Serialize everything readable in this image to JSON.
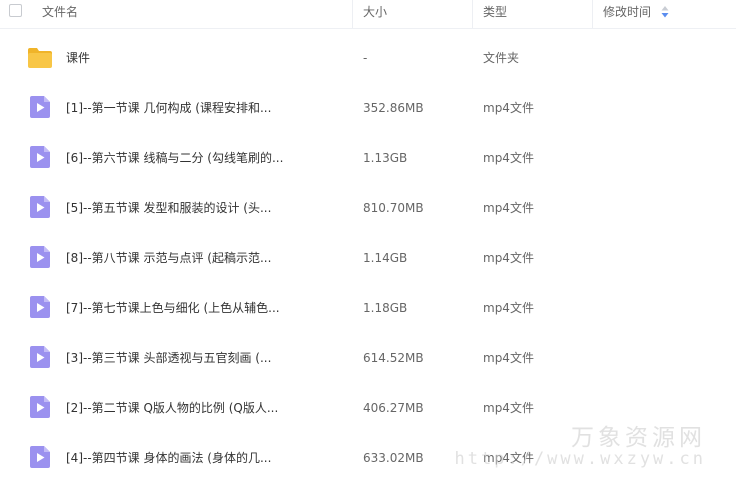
{
  "header": {
    "name_label": "文件名",
    "size_label": "大小",
    "type_label": "类型",
    "modified_label": "修改时间"
  },
  "colors": {
    "folder": "#f8c646",
    "video": "#9b91ef",
    "sort_active": "#5b8def"
  },
  "rows": [
    {
      "name": "课件",
      "size": "-",
      "type": "文件夹",
      "icon": "folder-icon"
    },
    {
      "name": "[1]--第一节课 几何构成 (课程安排和...",
      "size": "352.86MB",
      "type": "mp4文件",
      "icon": "video-file-icon"
    },
    {
      "name": "[6]--第六节课 线稿与二分 (勾线笔刷的...",
      "size": "1.13GB",
      "type": "mp4文件",
      "icon": "video-file-icon"
    },
    {
      "name": "[5]--第五节课 发型和服装的设计 (头...",
      "size": "810.70MB",
      "type": "mp4文件",
      "icon": "video-file-icon"
    },
    {
      "name": "[8]--第八节课 示范与点评 (起稿示范...",
      "size": "1.14GB",
      "type": "mp4文件",
      "icon": "video-file-icon"
    },
    {
      "name": "[7]--第七节课上色与细化 (上色从辅色...",
      "size": "1.18GB",
      "type": "mp4文件",
      "icon": "video-file-icon"
    },
    {
      "name": "[3]--第三节课 头部透视与五官刻画 (...",
      "size": "614.52MB",
      "type": "mp4文件",
      "icon": "video-file-icon"
    },
    {
      "name": "[2]--第二节课 Q版人物的比例 (Q版人...",
      "size": "406.27MB",
      "type": "mp4文件",
      "icon": "video-file-icon"
    },
    {
      "name": "[4]--第四节课 身体的画法 (身体的几...",
      "size": "633.02MB",
      "type": "mp4文件",
      "icon": "video-file-icon"
    }
  ],
  "watermark": {
    "title": "万象资源网",
    "url": "http://www.wxzyw.cn"
  }
}
